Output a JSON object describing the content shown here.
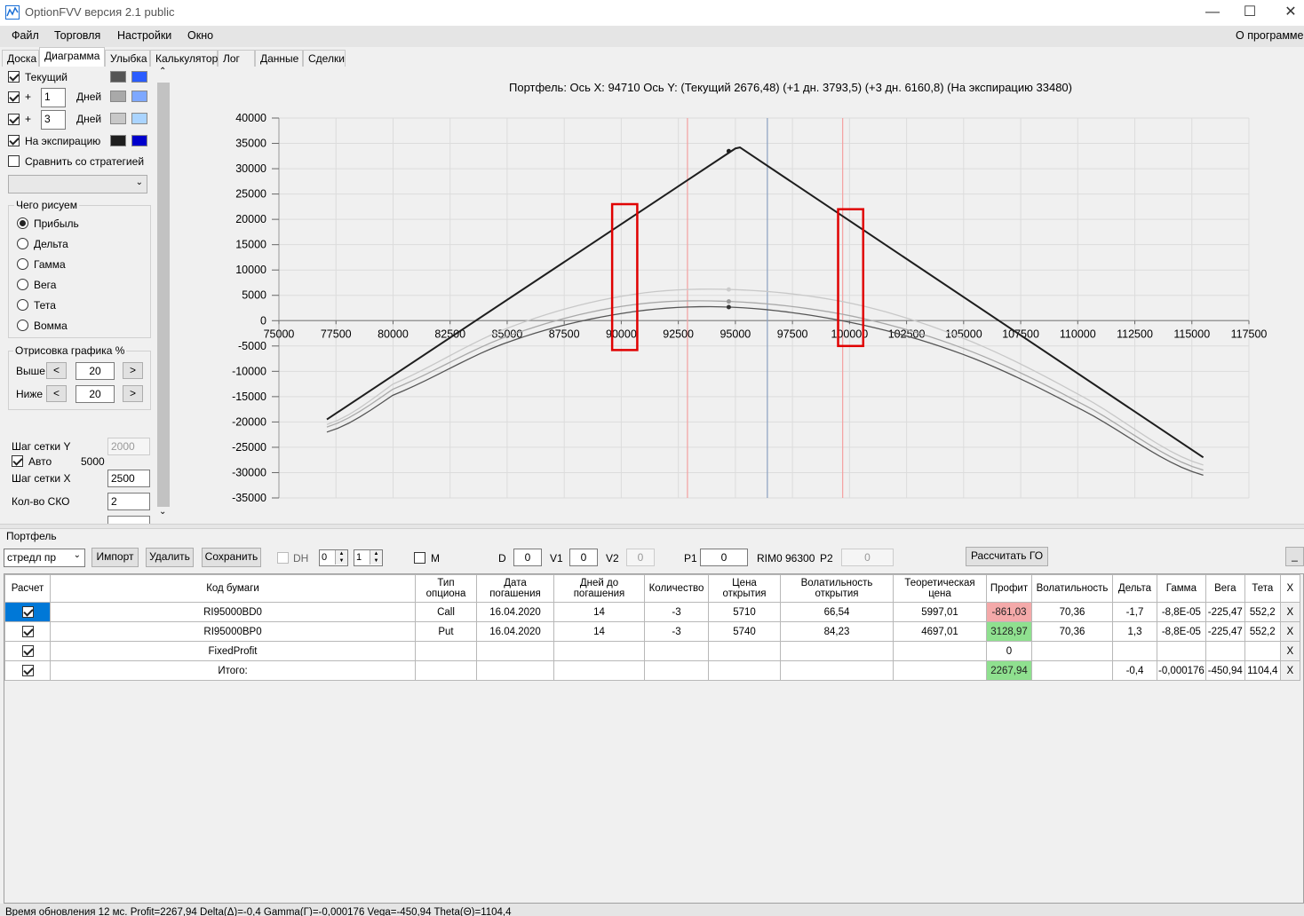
{
  "window": {
    "title": "OptionFVV версия 2.1 public",
    "minimize": "—",
    "maximize": "☐",
    "close": "✕"
  },
  "menu": {
    "items": [
      "Файл",
      "Торговля",
      "Настройки",
      "Окно"
    ],
    "about": "О программе"
  },
  "tabs": [
    "Доска",
    "Диаграмма",
    "Улыбка",
    "Калькулятор",
    "Лог",
    "Данные",
    "Сделки"
  ],
  "active_tab": "Диаграмма",
  "left_panel": {
    "rows": [
      {
        "label": "Текущий",
        "checked": true,
        "days": null,
        "color1": "#555555",
        "color2": "#2a5cff"
      },
      {
        "label": "+",
        "checked": true,
        "days": "1",
        "days_label": "Дней",
        "color1": "#a9a9a9",
        "color2": "#7ea8ff"
      },
      {
        "label": "+",
        "checked": true,
        "days": "3",
        "days_label": "Дней",
        "color1": "#c8c8c8",
        "color2": "#aad4ff"
      },
      {
        "label": "На экспирацию",
        "checked": true,
        "days": null,
        "color1": "#1e1e1e",
        "color2": "#0000cc"
      }
    ],
    "compare_label": "Сравнить со стратегией",
    "compare_checked": false,
    "what_draw_title": "Чего рисуем",
    "what_draw": [
      "Прибыль",
      "Дельта",
      "Гамма",
      "Вега",
      "Тета",
      "Вомма"
    ],
    "what_draw_selected": "Прибыль",
    "render_title": "Отрисовка графика %",
    "above_label": "Выше",
    "above_value": "20",
    "below_label": "Ниже",
    "below_value": "20",
    "btn_left": "<",
    "btn_right": ">",
    "grid_y_label": "Шаг сетки Y",
    "grid_y_value": "2000",
    "auto_label": "Авто",
    "auto_checked": true,
    "auto_value": "5000",
    "grid_x_label": "Шаг сетки X",
    "grid_x_value": "2500",
    "sko_label": "Кол-во СКО",
    "sko_value": "2"
  },
  "chart_data": {
    "type": "line",
    "title": "Портфель: Ось X: 94710 Ось Y:  (Текущий 2676,48)  (+1 дн. 3793,5)  (+3 дн. 6160,8)  (На экспирацию 33480)",
    "xlim": [
      75000,
      117500
    ],
    "ylim": [
      -35000,
      40000
    ],
    "x_ticks": [
      75000,
      77500,
      80000,
      82500,
      85000,
      87500,
      90000,
      92500,
      95000,
      97500,
      100000,
      102500,
      105000,
      107500,
      110000,
      112500,
      115000,
      117500
    ],
    "y_ticks": [
      40000,
      35000,
      30000,
      25000,
      20000,
      15000,
      10000,
      5000,
      0,
      -5000,
      -10000,
      -15000,
      -20000,
      -25000,
      -30000,
      -35000
    ],
    "vertical_lines": [
      {
        "x": 92900,
        "color": "#f4a0a0"
      },
      {
        "x": 96400,
        "color": "#8aa0c0"
      },
      {
        "x": 99700,
        "color": "#f4a0a0"
      }
    ],
    "series": [
      {
        "color": "#1e1e1e",
        "x": [
          77100,
          95000,
          95200,
          115500
        ],
        "y": [
          -19500,
          34000,
          34200,
          -27000
        ]
      },
      {
        "color": "#555555",
        "x": [
          77100,
          80000,
          85000,
          90000,
          94710,
          100000,
          105000,
          110000,
          115500
        ],
        "y": [
          -22000,
          -14700,
          -4300,
          1400,
          2676,
          -300,
          -6700,
          -17200,
          -30500
        ]
      },
      {
        "color": "#a9a9a9",
        "x": [
          77100,
          80000,
          85000,
          90000,
          94710,
          100000,
          105000,
          110000,
          115500
        ],
        "y": [
          -21000,
          -13500,
          -3100,
          2800,
          3793,
          1000,
          -5500,
          -16000,
          -29500
        ]
      },
      {
        "color": "#c8c8c8",
        "x": [
          77100,
          80000,
          85000,
          90000,
          94710,
          100000,
          105000,
          110000,
          115500
        ],
        "y": [
          -20500,
          -12500,
          -1500,
          4800,
          6160,
          3500,
          -3500,
          -14500,
          -28500
        ]
      }
    ],
    "markers": [
      {
        "x": 94710,
        "y": 33480,
        "color": "#1e1e1e"
      },
      {
        "x": 94710,
        "y": 2676,
        "color": "#333333"
      },
      {
        "x": 94710,
        "y": 3793,
        "color": "#999999"
      },
      {
        "x": 94710,
        "y": 6160,
        "color": "#cccccc"
      }
    ],
    "highlight_boxes": [
      {
        "x0": 89600,
        "x1": 90700,
        "y0": -5800,
        "y1": 23000
      },
      {
        "x0": 99500,
        "x1": 100600,
        "y0": -5000,
        "y1": 22000
      }
    ],
    "grid": true
  },
  "portfolio": {
    "label": "Портфель",
    "selector_value": "стредл пр",
    "import_label": "Импорт",
    "delete_label": "Удалить",
    "save_label": "Сохранить",
    "dh_label": "DH",
    "dh_spin1": "0",
    "dh_spin2": "1",
    "m_label": "M",
    "d_label": "D",
    "d_value": "0",
    "v1_label": "V1",
    "v1_value": "0",
    "v2_label": "V2",
    "v2_value": "0",
    "p1_label": "P1",
    "p1_value": "0",
    "rim_label": "RIM0 96300",
    "p2_label": "P2",
    "p2_value": "0",
    "calc_go_label": "Рассчитать ГО",
    "min_label": "_"
  },
  "grid": {
    "headers": [
      "Расчет",
      "Код бумаги",
      "Тип опциона",
      "Дата погашения",
      "Дней до погашения",
      "Количество",
      "Цена открытия",
      "Волатильность открытия",
      "Теоретическая цена",
      "Профит",
      "Волатильность",
      "Дельта",
      "Гамма",
      "Вега",
      "Тета",
      "X"
    ],
    "rows": [
      {
        "checked": true,
        "selected": true,
        "code": "RI95000BD0",
        "type": "Call",
        "date": "16.04.2020",
        "days": "14",
        "qty": "-3",
        "price": "5710",
        "vol_open": "66,54",
        "theo": "5997,01",
        "profit": "-861,03",
        "profit_sign": "neg",
        "vol": "70,36",
        "delta": "-1,7",
        "gamma": "-8,8E-05",
        "vega": "-225,47",
        "theta": "552,2",
        "x": "X"
      },
      {
        "checked": true,
        "selected": false,
        "code": "RI95000BP0",
        "type": "Put",
        "date": "16.04.2020",
        "days": "14",
        "qty": "-3",
        "price": "5740",
        "vol_open": "84,23",
        "theo": "4697,01",
        "profit": "3128,97",
        "profit_sign": "pos",
        "vol": "70,36",
        "delta": "1,3",
        "gamma": "-8,8E-05",
        "vega": "-225,47",
        "theta": "552,2",
        "x": "X"
      },
      {
        "checked": true,
        "selected": false,
        "code": "FixedProfit",
        "type": "",
        "date": "",
        "days": "",
        "qty": "",
        "price": "",
        "vol_open": "",
        "theo": "",
        "profit": "0",
        "profit_sign": "none",
        "vol": "",
        "delta": "",
        "gamma": "",
        "vega": "",
        "theta": "",
        "x": "X"
      },
      {
        "checked": true,
        "selected": false,
        "code": "Итого:",
        "type": "",
        "date": "",
        "days": "",
        "qty": "",
        "price": "",
        "vol_open": "",
        "theo": "",
        "profit": "2267,94",
        "profit_sign": "pos",
        "vol": "",
        "delta": "-0,4",
        "gamma": "-0,000176",
        "vega": "-450,94",
        "theta": "1104,4",
        "x": "X"
      }
    ]
  },
  "status": {
    "text": "Время обновления 12 мс. Profit=2267,94 Delta(Δ)=-0,4 Gamma(Γ)=-0,000176 Vega=-450,94 Theta(Θ)=1104,4"
  }
}
